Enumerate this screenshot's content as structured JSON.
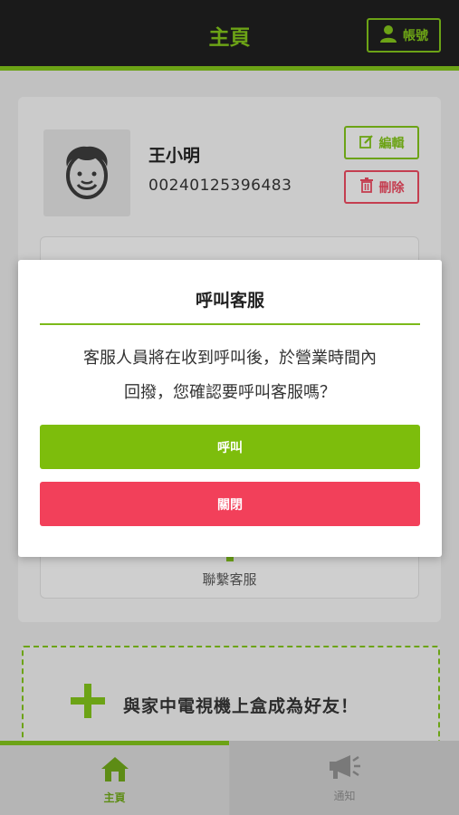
{
  "header": {
    "title": "主頁",
    "account_label": "帳號"
  },
  "profile": {
    "name": "王小明",
    "id": "00240125396483",
    "edit_label": "編輯",
    "delete_label": "刪除"
  },
  "inner_card": {
    "contact_label": "聯繫客服"
  },
  "add_friend": {
    "label": "與家中電視機上盒成為好友！"
  },
  "modal": {
    "title": "呼叫客服",
    "message_line1": "客服人員將在收到呼叫後，於營業時間內",
    "message_line2": "回撥，您確認要呼叫客服嗎？",
    "call_label": "呼叫",
    "close_label": "關閉"
  },
  "bottom_nav": {
    "items": [
      {
        "label": "主頁",
        "icon": "home-icon",
        "active": true
      },
      {
        "label": "通知",
        "icon": "megaphone-icon",
        "active": false
      }
    ]
  },
  "colors": {
    "accent": "#7cba1a",
    "danger": "#f2405a",
    "header_bg": "#1e1e1e"
  }
}
